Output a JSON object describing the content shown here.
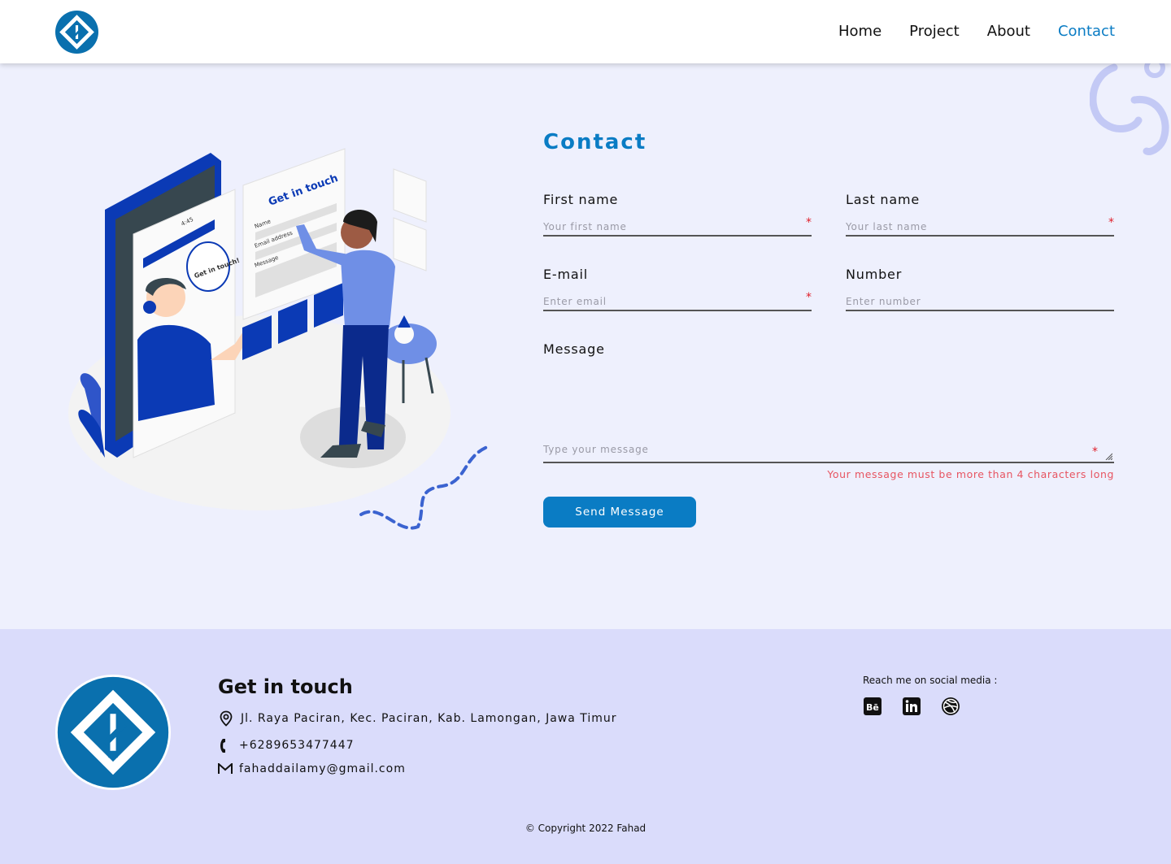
{
  "header": {
    "nav": [
      {
        "label": "Home",
        "active": false
      },
      {
        "label": "Project",
        "active": false
      },
      {
        "label": "About",
        "active": false
      },
      {
        "label": "Contact",
        "active": true
      }
    ]
  },
  "illustration": {
    "speech_bubble": "Get in touch!",
    "form_title": "Get in touch",
    "form_fields": [
      "Name",
      "Email address",
      "Message"
    ],
    "phone_time": "4:45"
  },
  "contact": {
    "title": "Contact",
    "first_name": {
      "label": "First name",
      "placeholder": "Your first name",
      "required_mark": "*"
    },
    "last_name": {
      "label": "Last name",
      "placeholder": "Your last name",
      "required_mark": "*"
    },
    "email": {
      "label": "E-mail",
      "placeholder": "Enter email",
      "required_mark": "*"
    },
    "number": {
      "label": "Number",
      "placeholder": "Enter number"
    },
    "message": {
      "label": "Message",
      "placeholder": "Type your message",
      "required_mark": "*"
    },
    "error": "Your message must be more than 4 characters long",
    "send_label": "Send Message"
  },
  "footer": {
    "title": "Get in touch",
    "address": "Jl. Raya Paciran, Kec. Paciran, Kab. Lamongan, Jawa Timur",
    "phone": "+6289653477447",
    "email": "fahaddailamy@gmail.com",
    "social_label": "Reach me on social media :",
    "social_icons": [
      "behance-icon",
      "linkedin-icon",
      "dribbble-icon"
    ],
    "copyright": "© Copyright 2022 Fahad"
  },
  "colors": {
    "accent": "#0a7cc4",
    "page_bg": "#eef0fd",
    "footer_bg": "#dadcfb",
    "error": "#e75461"
  }
}
